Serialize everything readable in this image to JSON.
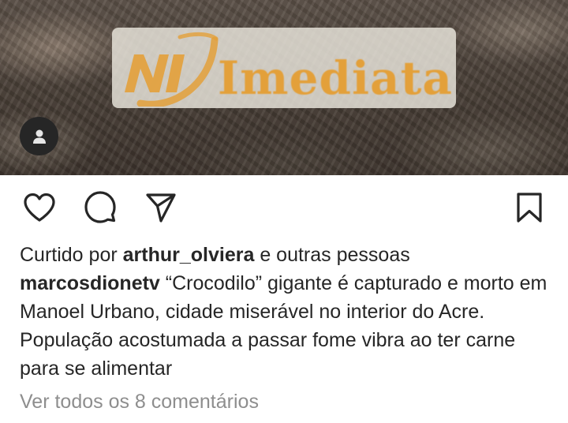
{
  "post": {
    "image": {
      "description_icon": "photo",
      "logo": {
        "text": "Imediata",
        "mark_text": "NI",
        "colors": {
          "mark": "#e3a03a",
          "box": "#ece8de"
        }
      },
      "avatar_icon": "person-icon"
    },
    "actions": {
      "like_icon": "heart-icon",
      "comment_icon": "comment-icon",
      "share_icon": "send-icon",
      "save_icon": "bookmark-icon"
    },
    "likes": {
      "prefix": "Curtido por",
      "user": "arthur_olviera",
      "suffix": "e outras pessoas"
    },
    "caption": {
      "username": "marcosdionetv",
      "text": "“Crocodilo” gigante é capturado e morto em Manoel Urbano, cidade miserável no interior do Acre. População acostumada a passar fome vibra ao ter carne para se alimentar"
    },
    "comments_link": "Ver todos os 8 comentários"
  }
}
